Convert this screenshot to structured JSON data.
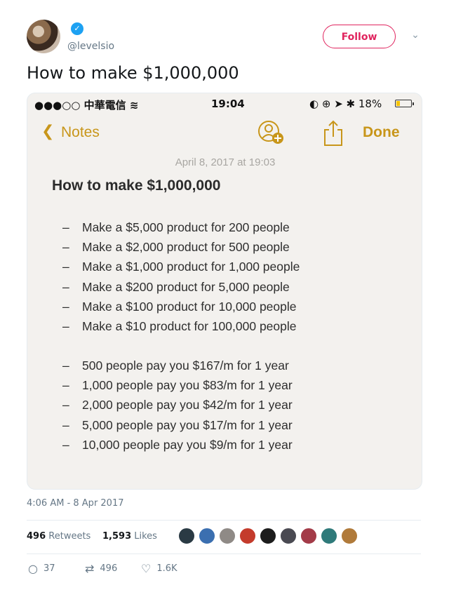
{
  "header": {
    "handle": "@levelsio",
    "follow_label": "Follow",
    "tweet_text": "How to make $1,000,000"
  },
  "screenshot": {
    "status_left": "●●●○○ 中華電信 ",
    "time": "19:04",
    "status_right": "◐ ⊕ ➤ ✱ 18%",
    "back_label": "Notes",
    "done_label": "Done",
    "date": "April 8, 2017 at 19:03",
    "title": "How to make $1,000,000",
    "list1": [
      "Make a $5,000 product for 200 people",
      "Make a $2,000 product for 500 people",
      "Make a $1,000 product for 1,000 people",
      "Make a $200 product for 5,000 people",
      "Make a $100 product for 10,000 people",
      "Make a $10 product for 100,000 people"
    ],
    "list2": [
      "500 people pay you $167/m for 1 year",
      "1,000 people pay you $83/m for 1 year",
      "2,000 people pay you $42/m for 1 year",
      "5,000 people pay you $17/m for 1 year",
      "10,000 people pay you $9/m for 1 year"
    ]
  },
  "footer": {
    "timestamp": "4:06 AM - 8 Apr 2017",
    "retweets_count": "496",
    "retweets_label": "Retweets",
    "likes_count": "1,593",
    "likes_label": "Likes",
    "replies": "37",
    "retweet_action": "496",
    "like_action": "1.6K"
  },
  "colors": {
    "accent": "#e0245e",
    "notes_gold": "#c8961a",
    "verified": "#1da1f2"
  }
}
